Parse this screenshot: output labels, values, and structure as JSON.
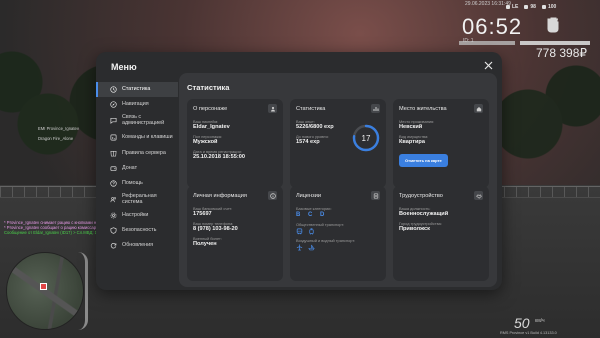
{
  "hud": {
    "date": "29.06.2023 16:31:49",
    "time": "06:52",
    "status": {
      "health": "LE",
      "armor": "98",
      "hunger": "100"
    },
    "id": "ID: 1",
    "money": "778 398₽",
    "speed": "50",
    "speed_unit": "км/ч",
    "version": "RMS Province v1 Build 4.13133.0"
  },
  "world": {
    "nametag1": "EMI Province_Ignatev",
    "nametag2": "Dragon Fire_Alone",
    "chat": [
      {
        "text": "* Province_Ignatev снимает рацию с кнопками на кармане и проверяет ее",
        "style": "pink"
      },
      {
        "text": "* Province_Ignatev сообщает о рацию комиссара информацию",
        "style": "pink"
      },
      {
        "text": "Сообщение от Eldar_Ignatev (ID17) > Сл.МВД: 11-4 10-4 19:00",
        "style": "green"
      }
    ]
  },
  "menu": {
    "title": "Меню",
    "content_title": "Статистика",
    "sidebar": [
      {
        "label": "Статистика",
        "icon": "clock-icon",
        "active": true
      },
      {
        "label": "Навигация",
        "icon": "compass-icon",
        "active": false
      },
      {
        "label": "Связь с администрацией",
        "icon": "chat-icon",
        "active": false
      },
      {
        "label": "Команды и клавиши",
        "icon": "command-icon",
        "active": false
      },
      {
        "label": "Правила сервера",
        "icon": "book-icon",
        "active": false
      },
      {
        "label": "Донат",
        "icon": "wallet-icon",
        "active": false
      },
      {
        "label": "Помощь",
        "icon": "help-icon",
        "active": false
      },
      {
        "label": "Реферальная система",
        "icon": "users-icon",
        "active": false
      },
      {
        "label": "Настройки",
        "icon": "gear-icon",
        "active": false
      },
      {
        "label": "Безопасность",
        "icon": "shield-icon",
        "active": false
      },
      {
        "label": "Обновления",
        "icon": "refresh-icon",
        "active": false
      }
    ],
    "cards": {
      "person": {
        "title": "О персонаже",
        "name_label": "Ваш никнейм:",
        "name": "Eldar_Ignatev",
        "gender_label": "Пол персонажа:",
        "gender": "Мужской",
        "reg_label": "Дата и время регистрации:",
        "reg": "25.10.2018 18:55:00"
      },
      "stats": {
        "title": "Статистика",
        "exp_label": "Ваш опыт:",
        "exp": "5226/6800 exp",
        "next_label": "До нового уровня:",
        "next": "1574 exp",
        "level": "17",
        "level_progress": 0.77
      },
      "home": {
        "title": "Место жительства",
        "place_label": "Место проживания:",
        "place": "Невский",
        "prop_label": "Вид имущества:",
        "prop": "Квартира",
        "button": "Отметить на карте"
      },
      "personal": {
        "title": "Личная информация",
        "bank_label": "Ваш банковский счет:",
        "bank": "175697",
        "phone_label": "Ваш номер телефона:",
        "phone": "8 (978) 103-98-20",
        "mil_label": "Военный билет:",
        "mil": "Получен"
      },
      "license": {
        "title": "Лицензии",
        "basic_label": "Базовые категории:",
        "basic": "B C D",
        "public_label": "Общественный транспорт:",
        "water_label": "Воздушный и водный транспорт:"
      },
      "job": {
        "title": "Трудоустройство",
        "pos_label": "Ваша должность:",
        "pos": "Военнослужащий",
        "city_label": "Город трудоустройства:",
        "city": "Приволжск"
      }
    }
  }
}
